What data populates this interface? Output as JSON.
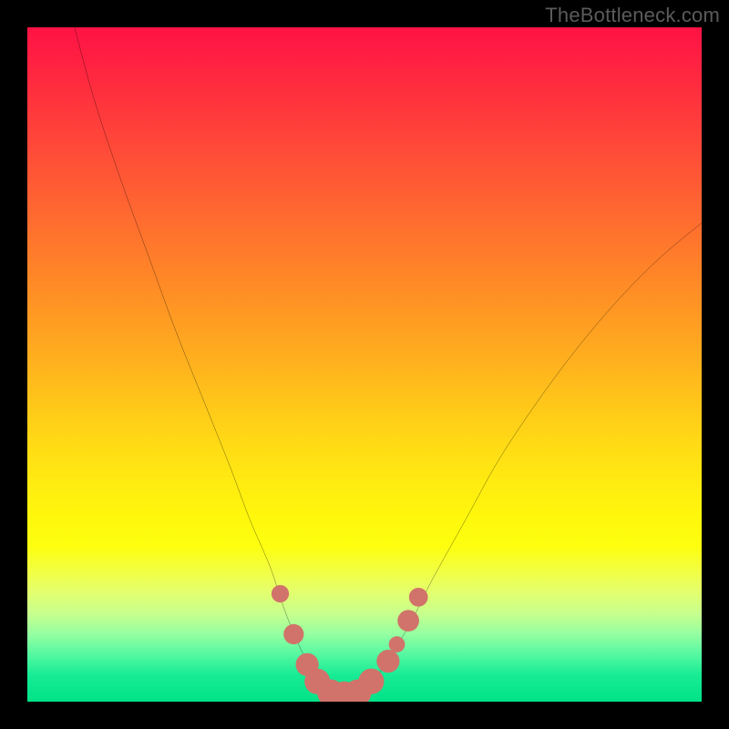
{
  "watermark": "TheBottleneck.com",
  "colors": {
    "frame_bg": "#000000",
    "curve": "#000000",
    "marker_fill": "#d1736a",
    "gradient_stops": [
      "#ff1245",
      "#ff2a3f",
      "#ff4a38",
      "#ff6a30",
      "#ff8a26",
      "#ffab1f",
      "#ffce18",
      "#ffe712",
      "#fff60c",
      "#fdff0f",
      "#f4ff3a",
      "#e5ff6b",
      "#c7ff8e",
      "#94ffa1",
      "#55f8a1",
      "#18ec95",
      "#00e287"
    ]
  },
  "chart_data": {
    "type": "line",
    "title": "",
    "xlabel": "",
    "ylabel": "",
    "xlim": [
      0,
      100
    ],
    "ylim": [
      0,
      100
    ],
    "series": [
      {
        "name": "bottleneck-curve",
        "x": [
          7,
          10,
          14,
          18,
          22,
          26,
          30,
          33,
          36,
          38,
          40,
          42,
          44,
          46,
          48,
          50,
          52,
          54,
          57,
          60,
          65,
          70,
          76,
          82,
          88,
          94,
          100
        ],
        "y": [
          100,
          89,
          77,
          66,
          55,
          45,
          35,
          27,
          20,
          14,
          9,
          5,
          2.5,
          1,
          1,
          2,
          4,
          7,
          12,
          18,
          27,
          36,
          45,
          53,
          60,
          66,
          71
        ]
      }
    ],
    "markers": [
      {
        "x": 37.5,
        "y": 16,
        "r": 1.3
      },
      {
        "x": 39.5,
        "y": 10,
        "r": 1.5
      },
      {
        "x": 41.5,
        "y": 5.5,
        "r": 1.7
      },
      {
        "x": 43,
        "y": 3,
        "r": 1.9
      },
      {
        "x": 45,
        "y": 1.3,
        "r": 2.0
      },
      {
        "x": 47,
        "y": 1.0,
        "r": 2.0
      },
      {
        "x": 49,
        "y": 1.3,
        "r": 2.0
      },
      {
        "x": 51,
        "y": 3,
        "r": 1.9
      },
      {
        "x": 53.5,
        "y": 6,
        "r": 1.7
      },
      {
        "x": 54.8,
        "y": 8.5,
        "r": 1.2
      },
      {
        "x": 56.5,
        "y": 12,
        "r": 1.6
      },
      {
        "x": 58,
        "y": 15.5,
        "r": 1.4
      }
    ]
  }
}
